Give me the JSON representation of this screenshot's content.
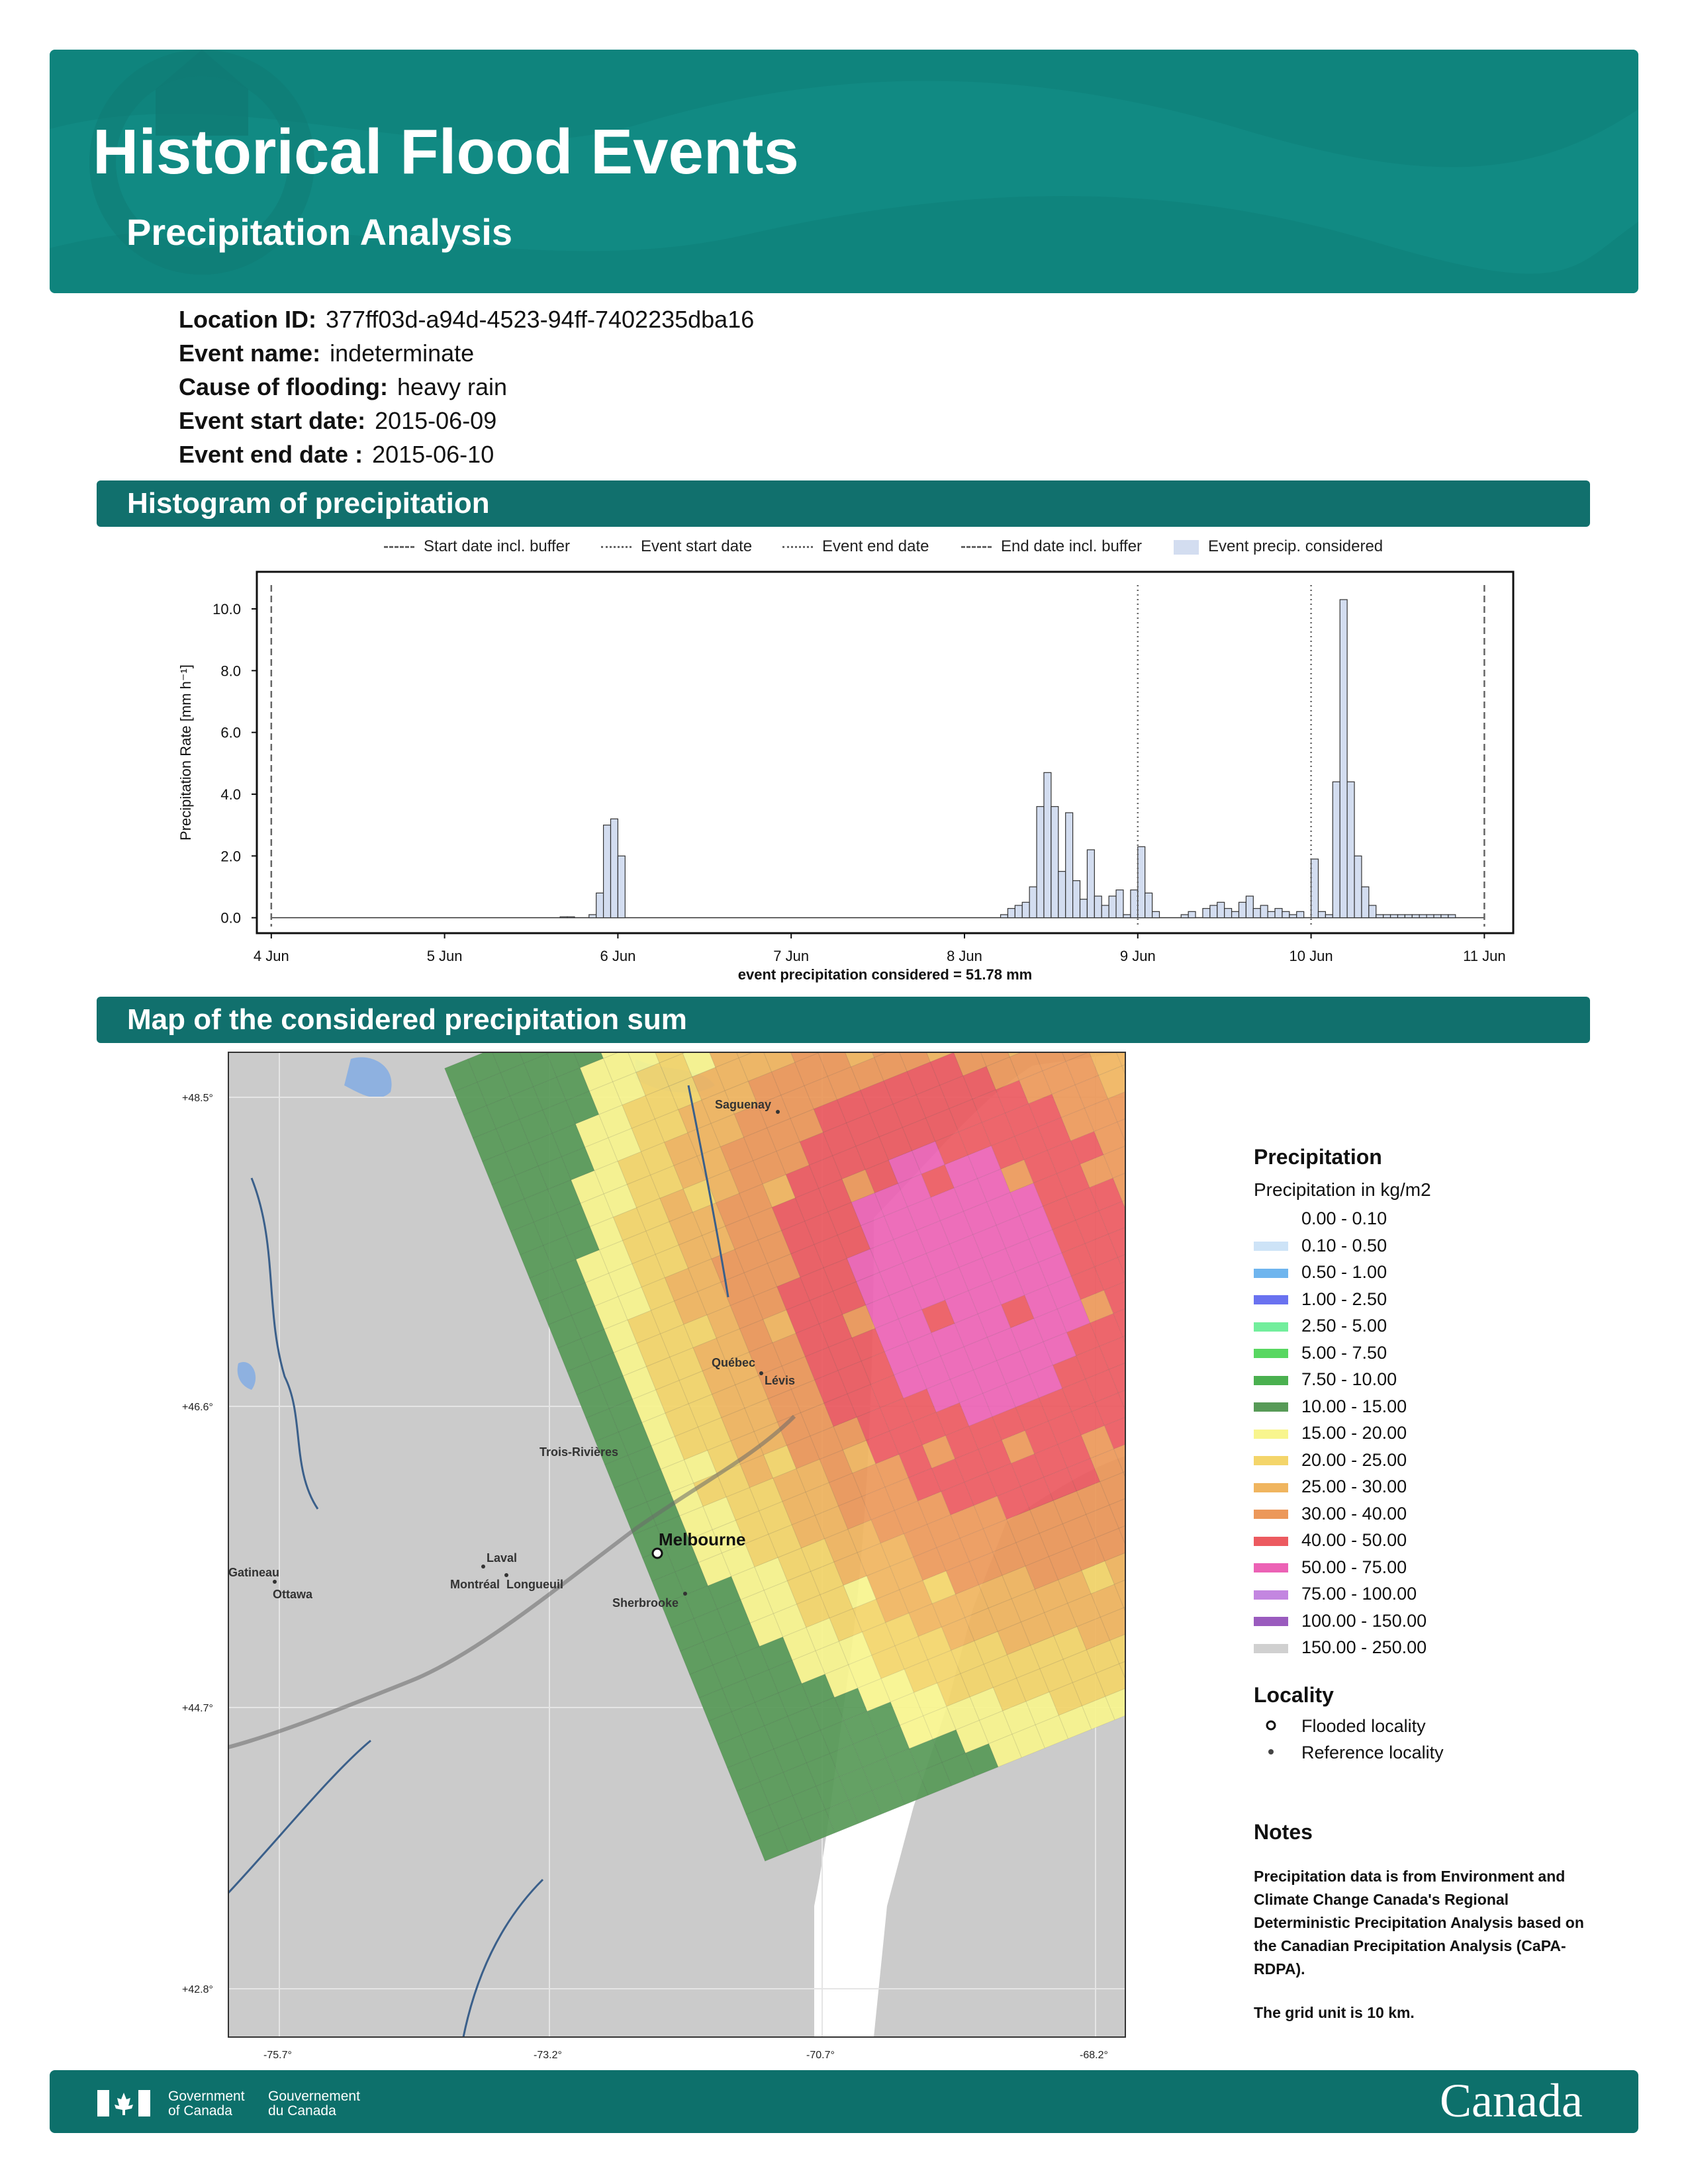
{
  "header": {
    "title": "Historical Flood Events",
    "subtitle": "Precipitation Analysis"
  },
  "info": [
    {
      "label": "Location ID:",
      "value": "377ff03d-a94d-4523-94ff-7402235dba16"
    },
    {
      "label": "Event name:",
      "value": "indeterminate"
    },
    {
      "label": "Cause of flooding:",
      "value": "heavy rain"
    },
    {
      "label": "Event start date:",
      "value": "2015-06-09"
    },
    {
      "label": "Event end date :",
      "value": "2015-06-10"
    }
  ],
  "sections": {
    "histogram": "Histogram of precipitation",
    "map": "Map of the considered precipitation sum"
  },
  "histogram_legend": [
    "Start date incl. buffer",
    "Event start date",
    "Event end date",
    "End date incl. buffer",
    "Event precip. considered"
  ],
  "chart_data": {
    "type": "bar",
    "ylabel": "Precipitation Rate [mm h⁻¹]",
    "ylim": [
      -0.5,
      11.2
    ],
    "xlim": [
      "2015-06-03 22:00",
      "2015-06-11 04:00"
    ],
    "x_ticks": [
      "4 Jun",
      "5 Jun",
      "6 Jun",
      "7 Jun",
      "8 Jun",
      "9 Jun",
      "10 Jun",
      "11 Jun"
    ],
    "y_ticks": [
      "0.0",
      "2.0",
      "4.0",
      "6.0",
      "8.0",
      "10.0"
    ],
    "xlabel": "event precipitation considered = 51.78 mm",
    "markers": {
      "start_buffer": "2015-06-04 00:00",
      "event_start": "2015-06-09 00:00",
      "event_end": "2015-06-10 00:00",
      "end_buffer": "2015-06-11 00:00"
    },
    "series": [
      {
        "bars": [
          {
            "t": "2015-06-05 16:00",
            "v": 0.03
          },
          {
            "t": "2015-06-05 17:00",
            "v": 0.03
          },
          {
            "t": "2015-06-05 20:00",
            "v": 0.1
          },
          {
            "t": "2015-06-05 21:00",
            "v": 0.8
          },
          {
            "t": "2015-06-05 22:00",
            "v": 3.0
          },
          {
            "t": "2015-06-05 23:00",
            "v": 3.2
          },
          {
            "t": "2015-06-06 00:00",
            "v": 2.0
          },
          {
            "t": "2015-06-08 05:00",
            "v": 0.1
          },
          {
            "t": "2015-06-08 06:00",
            "v": 0.3
          },
          {
            "t": "2015-06-08 07:00",
            "v": 0.4
          },
          {
            "t": "2015-06-08 08:00",
            "v": 0.5
          },
          {
            "t": "2015-06-08 09:00",
            "v": 1.0
          },
          {
            "t": "2015-06-08 10:00",
            "v": 3.6
          },
          {
            "t": "2015-06-08 11:00",
            "v": 4.7
          },
          {
            "t": "2015-06-08 12:00",
            "v": 3.6
          },
          {
            "t": "2015-06-08 13:00",
            "v": 1.5
          },
          {
            "t": "2015-06-08 14:00",
            "v": 3.4
          },
          {
            "t": "2015-06-08 15:00",
            "v": 1.2
          },
          {
            "t": "2015-06-08 16:00",
            "v": 0.6
          },
          {
            "t": "2015-06-08 17:00",
            "v": 2.2
          },
          {
            "t": "2015-06-08 18:00",
            "v": 0.7
          },
          {
            "t": "2015-06-08 19:00",
            "v": 0.4
          },
          {
            "t": "2015-06-08 20:00",
            "v": 0.7
          },
          {
            "t": "2015-06-08 21:00",
            "v": 0.9
          },
          {
            "t": "2015-06-08 22:00",
            "v": 0.1
          },
          {
            "t": "2015-06-08 23:00",
            "v": 0.9
          },
          {
            "t": "2015-06-09 00:00",
            "v": 2.3
          },
          {
            "t": "2015-06-09 01:00",
            "v": 0.8
          },
          {
            "t": "2015-06-09 02:00",
            "v": 0.2
          },
          {
            "t": "2015-06-09 06:00",
            "v": 0.1
          },
          {
            "t": "2015-06-09 07:00",
            "v": 0.2
          },
          {
            "t": "2015-06-09 09:00",
            "v": 0.3
          },
          {
            "t": "2015-06-09 10:00",
            "v": 0.4
          },
          {
            "t": "2015-06-09 11:00",
            "v": 0.5
          },
          {
            "t": "2015-06-09 12:00",
            "v": 0.3
          },
          {
            "t": "2015-06-09 13:00",
            "v": 0.2
          },
          {
            "t": "2015-06-09 14:00",
            "v": 0.5
          },
          {
            "t": "2015-06-09 15:00",
            "v": 0.7
          },
          {
            "t": "2015-06-09 16:00",
            "v": 0.3
          },
          {
            "t": "2015-06-09 17:00",
            "v": 0.4
          },
          {
            "t": "2015-06-09 18:00",
            "v": 0.2
          },
          {
            "t": "2015-06-09 19:00",
            "v": 0.3
          },
          {
            "t": "2015-06-09 20:00",
            "v": 0.2
          },
          {
            "t": "2015-06-09 21:00",
            "v": 0.1
          },
          {
            "t": "2015-06-09 22:00",
            "v": 0.2
          },
          {
            "t": "2015-06-10 00:00",
            "v": 1.9
          },
          {
            "t": "2015-06-10 01:00",
            "v": 0.2
          },
          {
            "t": "2015-06-10 02:00",
            "v": 0.1
          },
          {
            "t": "2015-06-10 03:00",
            "v": 4.4
          },
          {
            "t": "2015-06-10 04:00",
            "v": 10.3
          },
          {
            "t": "2015-06-10 05:00",
            "v": 4.4
          },
          {
            "t": "2015-06-10 06:00",
            "v": 2.0
          },
          {
            "t": "2015-06-10 07:00",
            "v": 1.0
          },
          {
            "t": "2015-06-10 08:00",
            "v": 0.4
          },
          {
            "t": "2015-06-10 09:00",
            "v": 0.1
          },
          {
            "t": "2015-06-10 10:00",
            "v": 0.1
          },
          {
            "t": "2015-06-10 11:00",
            "v": 0.1
          },
          {
            "t": "2015-06-10 12:00",
            "v": 0.1
          },
          {
            "t": "2015-06-10 13:00",
            "v": 0.1
          },
          {
            "t": "2015-06-10 14:00",
            "v": 0.1
          },
          {
            "t": "2015-06-10 15:00",
            "v": 0.1
          },
          {
            "t": "2015-06-10 16:00",
            "v": 0.1
          },
          {
            "t": "2015-06-10 17:00",
            "v": 0.1
          },
          {
            "t": "2015-06-10 18:00",
            "v": 0.1
          },
          {
            "t": "2015-06-10 19:00",
            "v": 0.1
          }
        ]
      }
    ]
  },
  "map": {
    "lat_labels": [
      "+48.5°",
      "+46.6°",
      "+44.7°",
      "+42.8°"
    ],
    "lon_labels": [
      "-75.7°",
      "-73.2°",
      "-70.7°",
      "-68.2°"
    ],
    "cities": [
      "Saguenay",
      "Québec",
      "Lévis",
      "Trois-Rivières",
      "Laval",
      "Montréal",
      "Longueuil",
      "Gatineau",
      "Ottawa",
      "Sherbrooke"
    ],
    "flooded_locality": "Melbourne"
  },
  "precip_legend": {
    "title": "Precipitation",
    "subtitle": "Precipitation in kg/m2",
    "classes": [
      {
        "label": "0.00 - 0.10",
        "color": "#ffffff"
      },
      {
        "label": "0.10 - 0.50",
        "color": "#cde3f7"
      },
      {
        "label": "0.50 - 1.00",
        "color": "#6fb5ee"
      },
      {
        "label": "1.00 - 2.50",
        "color": "#6a72f0"
      },
      {
        "label": "2.50 - 5.00",
        "color": "#72ee9c"
      },
      {
        "label": "5.00 - 7.50",
        "color": "#58d761"
      },
      {
        "label": "7.50 - 10.00",
        "color": "#4ab04f"
      },
      {
        "label": "10.00 - 15.00",
        "color": "#579a57"
      },
      {
        "label": "15.00 - 20.00",
        "color": "#f8f58e"
      },
      {
        "label": "20.00 - 25.00",
        "color": "#f4d56a"
      },
      {
        "label": "25.00 - 30.00",
        "color": "#f0b55f"
      },
      {
        "label": "30.00 - 40.00",
        "color": "#ec985a"
      },
      {
        "label": "40.00 - 50.00",
        "color": "#ec5a60"
      },
      {
        "label": "50.00 - 75.00",
        "color": "#ec62b5"
      },
      {
        "label": "75.00 - 100.00",
        "color": "#c386e0"
      },
      {
        "label": "100.00 - 150.00",
        "color": "#9a5bbe"
      },
      {
        "label": "150.00 - 250.00",
        "color": "#d0d0d0"
      }
    ]
  },
  "locality_legend": {
    "title": "Locality",
    "flooded": "Flooded locality",
    "reference": "Reference locality"
  },
  "notes": {
    "title": "Notes",
    "text": "Precipitation data is from Environment and Climate Change Canada's Regional Deterministic Precipitation Analysis based on the Canadian Precipitation Analysis (CaPA-RDPA).",
    "grid": "The grid unit is 10 km."
  },
  "footer": {
    "gov_en_1": "Government",
    "gov_en_2": "of Canada",
    "gov_fr_1": "Gouvernement",
    "gov_fr_2": "du Canada",
    "wordmark": "Canada"
  }
}
